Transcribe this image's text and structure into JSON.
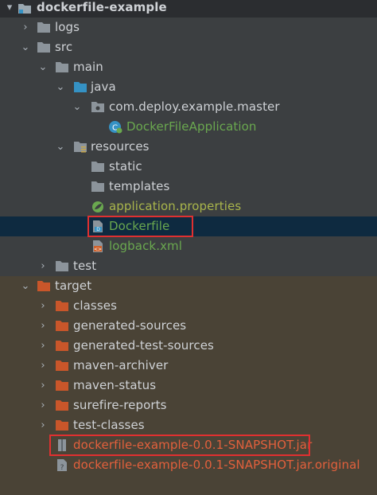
{
  "project": {
    "root": "dockerfile-example",
    "items": [
      {
        "label": "logs",
        "kind": "folder"
      },
      {
        "label": "src",
        "kind": "folder"
      },
      {
        "label": "main",
        "kind": "folder"
      },
      {
        "label": "java",
        "kind": "source-folder"
      },
      {
        "label": "com.deploy.example.master",
        "kind": "package"
      },
      {
        "label": "DockerFileApplication",
        "kind": "java-class"
      },
      {
        "label": "resources",
        "kind": "resources-folder"
      },
      {
        "label": "static",
        "kind": "folder"
      },
      {
        "label": "templates",
        "kind": "folder"
      },
      {
        "label": "application.properties",
        "kind": "properties-file"
      },
      {
        "label": "Dockerfile",
        "kind": "dockerfile"
      },
      {
        "label": "logback.xml",
        "kind": "xml-file"
      },
      {
        "label": "test",
        "kind": "folder"
      },
      {
        "label": "target",
        "kind": "excluded-folder"
      },
      {
        "label": "classes",
        "kind": "excluded-folder"
      },
      {
        "label": "generated-sources",
        "kind": "excluded-folder"
      },
      {
        "label": "generated-test-sources",
        "kind": "excluded-folder"
      },
      {
        "label": "maven-archiver",
        "kind": "excluded-folder"
      },
      {
        "label": "maven-status",
        "kind": "excluded-folder"
      },
      {
        "label": "surefire-reports",
        "kind": "excluded-folder"
      },
      {
        "label": "test-classes",
        "kind": "excluded-folder"
      },
      {
        "label": "dockerfile-example-0.0.1-SNAPSHOT.jar",
        "kind": "jar-file"
      },
      {
        "label": "dockerfile-example-0.0.1-SNAPSHOT.jar.original",
        "kind": "file"
      }
    ]
  },
  "colors": {
    "background": "#3c3f41",
    "selection": "#0e2a40",
    "target_bg": "#4a4336",
    "highlight_box": "#e03030",
    "java_green": "#6aa84f",
    "excluded_red": "#e2603c"
  }
}
